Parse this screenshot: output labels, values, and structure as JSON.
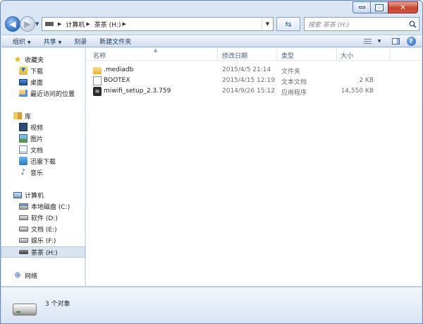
{
  "address": {
    "crumbs": [
      "计算机",
      "茶茶 (H:)"
    ]
  },
  "search": {
    "placeholder": "搜索 茶茶 (H:)"
  },
  "toolbar": {
    "organize": "组织",
    "share": "共享",
    "burn": "刻录",
    "new_folder": "新建文件夹"
  },
  "nav": {
    "favorites": "收藏夹",
    "downloads": "下载",
    "desktop": "桌面",
    "recent": "最近访问的位置",
    "libraries": "库",
    "videos": "视频",
    "pictures": "图片",
    "documents": "文档",
    "xunlei": "迅雷下载",
    "music": "音乐",
    "computer": "计算机",
    "drive_c": "本地磁盘 (C:)",
    "drive_d": "软件 (D:)",
    "drive_e": "文档 (E:)",
    "drive_f": "娱乐 (F:)",
    "drive_h": "茶茶 (H:)",
    "network": "网络"
  },
  "columns": {
    "name": "名称",
    "modified": "修改日期",
    "type": "类型",
    "size": "大小"
  },
  "files": [
    {
      "name": ".mediadb",
      "modified": "2015/4/5 21:14",
      "type": "文件夹",
      "size": "",
      "icon": "folder-icon"
    },
    {
      "name": "BOOTEX",
      "modified": "2015/4/15 12:19",
      "type": "文本文档",
      "size": "2 KB",
      "icon": "text-file-icon"
    },
    {
      "name": "miwifi_setup_2.3.759",
      "modified": "2014/9/26 15:12",
      "type": "应用程序",
      "size": "14,550 KB",
      "icon": "wifi-app-icon"
    }
  ],
  "status": {
    "count": "3 个对象"
  },
  "colors": {
    "selection": "#d9e4f1",
    "chrome": "#dbe7f5",
    "toolbar_text": "#1e395b"
  }
}
